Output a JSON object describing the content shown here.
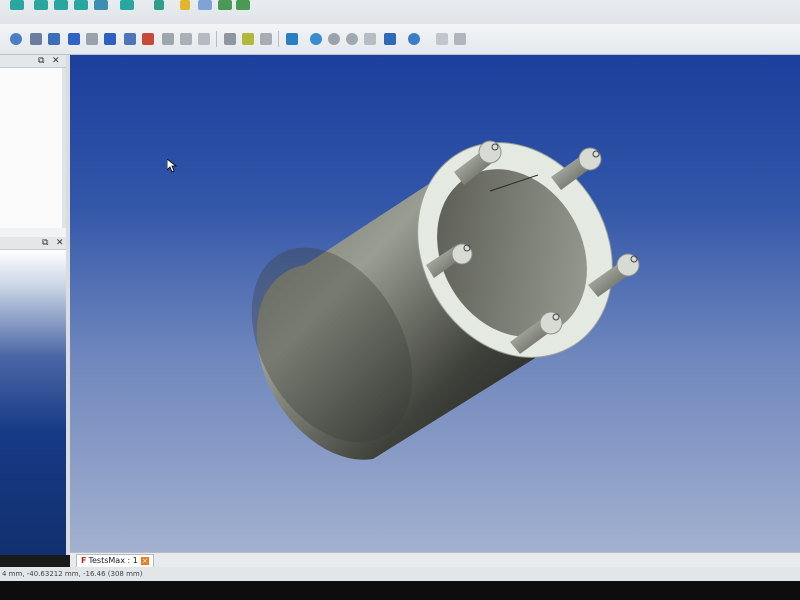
{
  "document_tab": {
    "label": "TestsMax : 1"
  },
  "statusbar": {
    "text": "4 mm, -40.63212 mm, -16.46 (308 mm)"
  },
  "colors": {
    "view_top": "#1b3f9c",
    "view_bottom": "#a3b1cf",
    "solid_dark": "#2f302c",
    "solid_light": "#8f9286",
    "face_light": "#e8eee8"
  },
  "icons": {
    "toolbar_top": [
      "cube-view-icon",
      "cube-front-icon",
      "cube-top-icon",
      "cube-right-icon",
      "cube-rear-icon",
      "measure-icon",
      "link-icon",
      "folder-icon",
      "copy-icon"
    ],
    "toolbar_view": [
      "fit-all-icon",
      "fit-selection-icon",
      "draw-style-icon",
      "stereo-icon",
      "view-iso-icon",
      "view-front-icon",
      "view-top-icon",
      "view-right-icon",
      "view-rear-icon",
      "view-bottom-icon",
      "view-left-icon",
      "measure-distance-icon",
      "box-primitive-icon",
      "cylinder-primitive-icon",
      "sphere-primitive-icon",
      "cone-primitive-icon",
      "torus-primitive-icon",
      "tube-primitive-icon",
      "boolean-icon",
      "cut-icon",
      "fuse-icon",
      "section-icon",
      "chamfer-icon",
      "fillet-icon"
    ]
  },
  "panels": {
    "top_panel_controls": [
      "⧉",
      "✕"
    ],
    "bottom_panel_controls": [
      "⧉",
      "✕"
    ]
  }
}
